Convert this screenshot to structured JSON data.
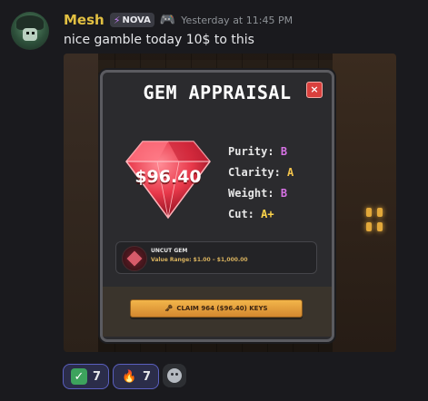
{
  "message": {
    "username": "Mesh",
    "tag_label": "NOVA",
    "timestamp": "Yesterday at 11:45 PM",
    "text": "nice gamble today 10$ to this"
  },
  "modal": {
    "title": "GEM APPRAISAL",
    "close_label": "×",
    "gem_value": "$96.40",
    "stats": [
      {
        "label": "Purity:",
        "value": "B"
      },
      {
        "label": "Clarity:",
        "value": "A"
      },
      {
        "label": "Weight:",
        "value": "B"
      },
      {
        "label": "Cut:",
        "value": "A+"
      }
    ],
    "uncut": {
      "title": "UNCUT GEM",
      "range": "Value Range: $1.00 – $1,000.00"
    },
    "claim_label": "CLAIM 964 ($96.40) KEYS"
  },
  "reactions": [
    {
      "emoji_name": "check-icon",
      "count": "7"
    },
    {
      "emoji_name": "fire-icon",
      "count": "7"
    }
  ],
  "colors": {
    "username": "#e2c042",
    "accent_border": "#5a5fbf",
    "claim_button": "#f2b54a",
    "close_button": "#d9403d",
    "gem": "#e8384a"
  }
}
